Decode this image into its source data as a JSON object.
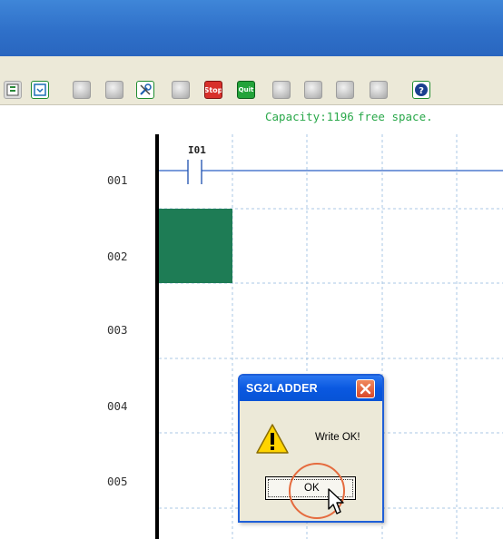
{
  "toolbar": {
    "icons": [
      "panel-icon",
      "download-icon",
      "refresh-icon",
      "cube-icon",
      "tool-icon",
      "globe-icon",
      "stop-button",
      "quit-button",
      "circle-icon",
      "pen-icon",
      "page-icon",
      "stack-icon",
      "help-icon"
    ],
    "stop_label": "Stop",
    "quit_label": "Quit"
  },
  "status": {
    "capacity_label": "Capacity:1196",
    "capacity_suffix": "free space."
  },
  "ladder": {
    "rungs": [
      "001",
      "002",
      "003",
      "004",
      "005"
    ],
    "contact_label": "I01",
    "selected_color": "#1e7c55"
  },
  "dialog": {
    "title": "SG2LADDER",
    "message": "Write OK!",
    "ok_label": "OK",
    "icon": "warning-icon"
  },
  "colors": {
    "title_bar": "#2f70c9",
    "capacity_text": "#2aa84a",
    "highlight": "#e56b3e"
  }
}
